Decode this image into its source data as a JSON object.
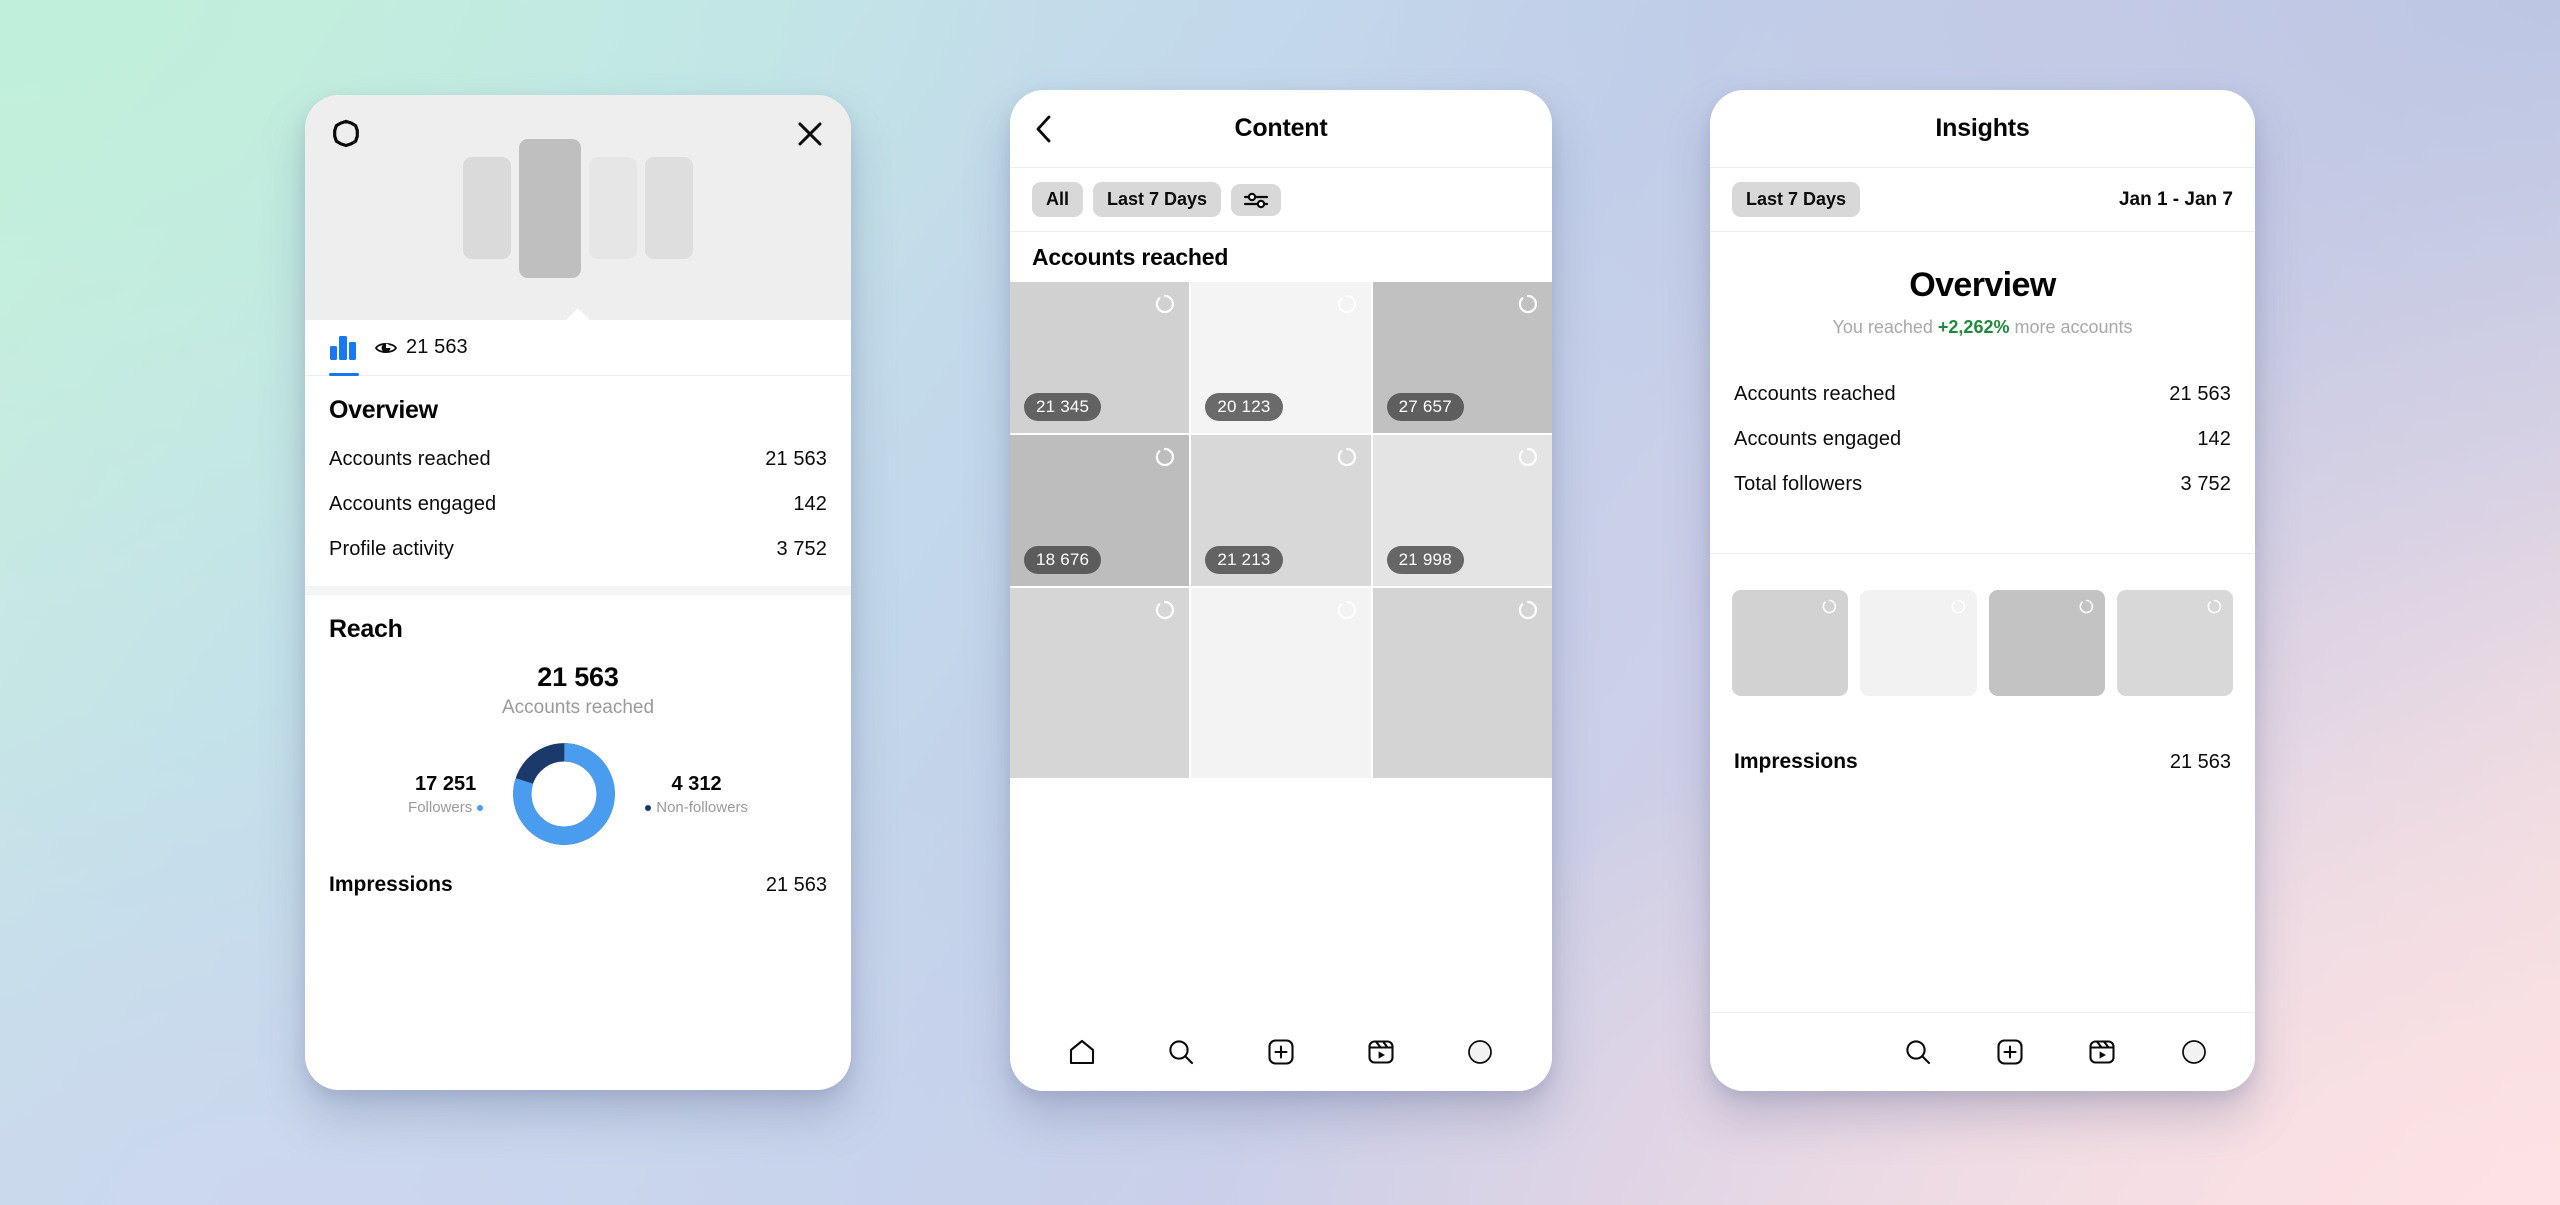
{
  "background": {
    "gradient_from": "#cdeedd",
    "gradient_mid": "#c3d0ea",
    "gradient_to": "#f6dfe0"
  },
  "colors": {
    "accent_blue": "#1877f2",
    "donut_followers": "#4a9cef",
    "donut_non_followers": "#1b3a6b",
    "positive_green": "#1f8a3d",
    "chip_gray": "#d8d8d8"
  },
  "phone_detail": {
    "header": {
      "boost_icon": "octagon-icon",
      "close_icon": "close-icon",
      "carousel_slides": [
        "slide-1",
        "slide-2",
        "slide-3",
        "slide-4"
      ]
    },
    "metric_strip": {
      "chart_tab_icon": "bar-chart-icon",
      "views_icon": "eye-icon",
      "views_count": "21 563"
    },
    "overview": {
      "title": "Overview",
      "rows": [
        {
          "label": "Accounts reached",
          "value": "21 563"
        },
        {
          "label": "Accounts engaged",
          "value": "142"
        },
        {
          "label": "Profile activity",
          "value": "3 752"
        }
      ]
    },
    "reach": {
      "title": "Reach",
      "big_value": "21 563",
      "big_label": "Accounts reached",
      "legend_left": {
        "value": "17 251",
        "label": "Followers"
      },
      "legend_right": {
        "value": "4 312",
        "label": "Non-followers"
      }
    },
    "impressions": {
      "label": "Impressions",
      "value": "21 563"
    }
  },
  "phone_content": {
    "topbar": {
      "back_icon": "chevron-left-icon",
      "title": "Content"
    },
    "filters": [
      {
        "label": "All"
      },
      {
        "label": "Last 7 Days"
      }
    ],
    "filter_settings_icon": "sliders-icon",
    "section_label": "Accounts reached",
    "grid": [
      {
        "value": "21 345",
        "shade": "#d1d1d1"
      },
      {
        "value": "20 123",
        "shade": "#f4f4f4"
      },
      {
        "value": "27 657",
        "shade": "#c1c1c1"
      },
      {
        "value": "18 676",
        "shade": "#bdbdbd"
      },
      {
        "value": "21 213",
        "shade": "#d8d8d8"
      },
      {
        "value": "21 998",
        "shade": "#e4e4e4"
      },
      {
        "value": "",
        "shade": "#d6d6d6"
      },
      {
        "value": "",
        "shade": "#f3f3f3"
      },
      {
        "value": "",
        "shade": "#d4d4d4"
      }
    ],
    "tabbar": [
      {
        "icon": "home-icon"
      },
      {
        "icon": "search-icon"
      },
      {
        "icon": "add-post-icon"
      },
      {
        "icon": "reels-icon"
      },
      {
        "icon": "profile-avatar-icon"
      }
    ]
  },
  "phone_insights": {
    "topbar": {
      "title": "Insights"
    },
    "filter": {
      "chip": "Last 7 Days",
      "range": "Jan 1 - Jan 7"
    },
    "hero": {
      "title": "Overview",
      "sub_prefix": "You reached ",
      "sub_highlight": "+2,262%",
      "sub_suffix": " more accounts"
    },
    "rows": [
      {
        "label": "Accounts reached",
        "value": "21 563"
      },
      {
        "label": "Accounts engaged",
        "value": "142"
      },
      {
        "label": "Total followers",
        "value": "3 752"
      }
    ],
    "thumbs": [
      {
        "shade": "#d2d2d2"
      },
      {
        "shade": "#f2f2f2"
      },
      {
        "shade": "#c3c3c3"
      },
      {
        "shade": "#d8d8d8"
      }
    ],
    "impressions": {
      "label": "Impressions",
      "value": "21 563"
    },
    "tabbar": [
      {
        "icon": "search-icon"
      },
      {
        "icon": "add-post-icon"
      },
      {
        "icon": "reels-icon"
      },
      {
        "icon": "profile-avatar-icon"
      }
    ]
  },
  "chart_data": {
    "type": "pie",
    "title": "Reach",
    "subtitle": "Accounts reached",
    "total": 21563,
    "categories": [
      "Followers",
      "Non-followers"
    ],
    "values": [
      17251,
      4312
    ],
    "colors": [
      "#4a9cef",
      "#1b3a6b"
    ],
    "legend": "sides",
    "donut": true
  }
}
